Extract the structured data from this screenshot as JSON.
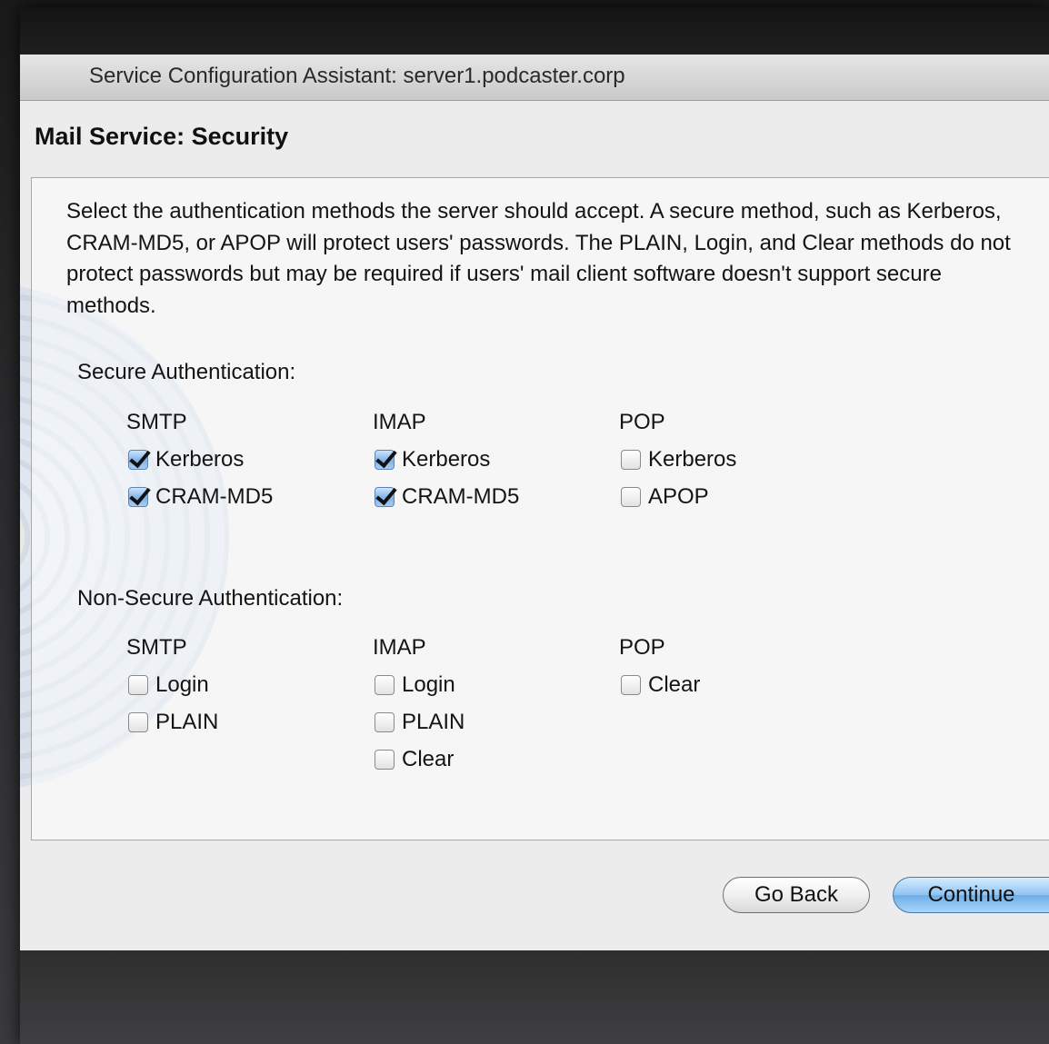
{
  "window": {
    "title": "Service Configuration Assistant: server1.podcaster.corp"
  },
  "page": {
    "heading": "Mail Service: Security",
    "description": "Select the authentication methods the server should accept. A secure method, such as Kerberos, CRAM-MD5, or APOP will protect users' passwords. The PLAIN, Login, and Clear methods do not protect passwords but may be required if users' mail client software doesn't support secure methods."
  },
  "secure": {
    "label": "Secure Authentication:",
    "columns": [
      {
        "header": "SMTP",
        "options": [
          {
            "label": "Kerberos",
            "checked": true
          },
          {
            "label": "CRAM-MD5",
            "checked": true
          }
        ]
      },
      {
        "header": "IMAP",
        "options": [
          {
            "label": "Kerberos",
            "checked": true
          },
          {
            "label": "CRAM-MD5",
            "checked": true
          }
        ]
      },
      {
        "header": "POP",
        "options": [
          {
            "label": "Kerberos",
            "checked": false
          },
          {
            "label": "APOP",
            "checked": false
          }
        ]
      }
    ]
  },
  "nonsecure": {
    "label": "Non-Secure Authentication:",
    "columns": [
      {
        "header": "SMTP",
        "options": [
          {
            "label": "Login",
            "checked": false
          },
          {
            "label": "PLAIN",
            "checked": false
          }
        ]
      },
      {
        "header": "IMAP",
        "options": [
          {
            "label": "Login",
            "checked": false
          },
          {
            "label": "PLAIN",
            "checked": false
          },
          {
            "label": "Clear",
            "checked": false
          }
        ]
      },
      {
        "header": "POP",
        "options": [
          {
            "label": "Clear",
            "checked": false
          }
        ]
      }
    ]
  },
  "buttons": {
    "back": "Go Back",
    "continue": "Continue"
  },
  "colors": {
    "checkbox_checked": "#7fb2ea",
    "default_button": "#8ec3f2"
  }
}
